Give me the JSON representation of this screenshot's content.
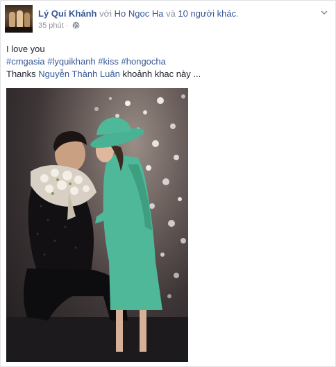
{
  "post": {
    "author": "Lý Quí Khánh",
    "with_word": " với ",
    "tagged": "Ho Ngoc Ha",
    "and_word": " và ",
    "others": "10 người khác",
    "period": ".",
    "timestamp": "35 phút",
    "separator": " · ",
    "privacy_icon": "globe-icon",
    "menu_icon": "chevron-down-icon",
    "line1": "I love you",
    "hashtags": [
      "#cmgasia",
      "#lyquikhanh",
      "#kiss",
      "#hongocha"
    ],
    "thanks_prefix": "Thanks ",
    "thanks_name": "Nguyễn Thành Luân",
    "thanks_suffix": " khoảnh khac này ...",
    "photo_alt_icon": "photo"
  },
  "colors": {
    "link": "#365899",
    "muted": "#90949c",
    "text": "#1d2129",
    "dress": "#4fb898"
  }
}
